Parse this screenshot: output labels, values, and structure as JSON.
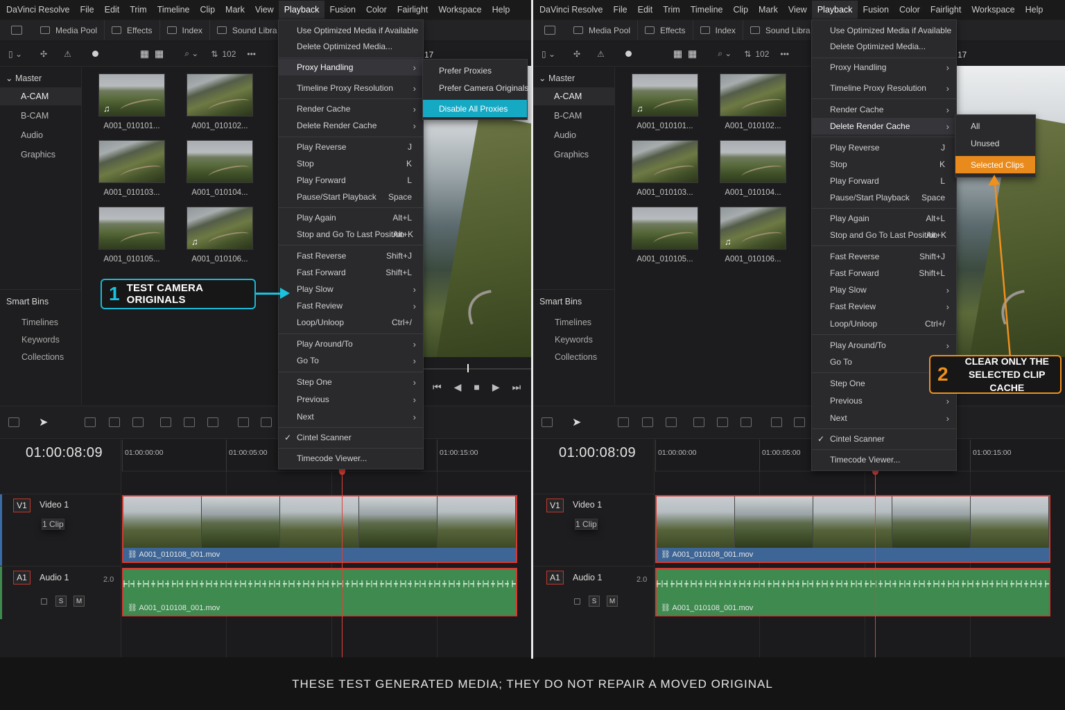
{
  "menubar": [
    "DaVinci Resolve",
    "File",
    "Edit",
    "Trim",
    "Timeline",
    "Clip",
    "Mark",
    "View",
    "Playback",
    "Fusion",
    "Color",
    "Fairlight",
    "Workspace",
    "Help"
  ],
  "toolbar": {
    "media_pool": "Media Pool",
    "effects": "Effects",
    "index": "Index",
    "sound_library": "Sound Libra",
    "zoom_count": "102"
  },
  "sidebar": {
    "master": "Master",
    "bins": [
      "A-CAM",
      "B-CAM",
      "Audio",
      "Graphics"
    ],
    "smart_bins_title": "Smart Bins",
    "smart_bins": [
      "Timelines",
      "Keywords",
      "Collections"
    ]
  },
  "clips": [
    "A001_010101...",
    "A001_010102...",
    "A001_010103...",
    "A001_010104...",
    "A001_010105...",
    "A001_010106..."
  ],
  "viewer": {
    "timecode_left": "17",
    "timecode_right": "17"
  },
  "timeline": {
    "timecode": "01:00:08:09",
    "ruler": [
      "01:00:00:00",
      "01:00:05:00",
      "01:00:15:00"
    ],
    "video_track": {
      "badge": "V1",
      "name": "Video 1",
      "sub": "1 Clip"
    },
    "audio_track": {
      "badge": "A1",
      "name": "Audio 1",
      "level": "2.0",
      "solo": "S",
      "mute": "M"
    },
    "clip_name": "A001_010108_001.mov"
  },
  "playback_menu": {
    "items": [
      {
        "label": "Use Optimized Media if Available"
      },
      {
        "label": "Delete Optimized Media..."
      },
      {
        "label": "Proxy Handling",
        "submenu": true
      },
      {
        "label": "Timeline Proxy Resolution",
        "submenu": true
      },
      {
        "label": "Render Cache",
        "submenu": true
      },
      {
        "label": "Delete Render Cache",
        "submenu": true
      },
      {
        "label": "Play Reverse",
        "shortcut": "J"
      },
      {
        "label": "Stop",
        "shortcut": "K"
      },
      {
        "label": "Play Forward",
        "shortcut": "L"
      },
      {
        "label": "Pause/Start Playback",
        "shortcut": "Space"
      },
      {
        "label": "Play Again",
        "shortcut": "Alt+L"
      },
      {
        "label": "Stop and Go To Last Position",
        "shortcut": "Alt+K"
      },
      {
        "label": "Fast Reverse",
        "shortcut": "Shift+J"
      },
      {
        "label": "Fast Forward",
        "shortcut": "Shift+L"
      },
      {
        "label": "Play Slow",
        "submenu": true
      },
      {
        "label": "Fast Review",
        "submenu": true
      },
      {
        "label": "Loop/Unloop",
        "shortcut": "Ctrl+/"
      },
      {
        "label": "Play Around/To",
        "submenu": true
      },
      {
        "label": "Go To",
        "submenu": true
      },
      {
        "label": "Step One",
        "submenu": true
      },
      {
        "label": "Previous",
        "submenu": true
      },
      {
        "label": "Next",
        "submenu": true
      },
      {
        "label": "Cintel Scanner",
        "checked": true
      },
      {
        "label": "Timecode Viewer..."
      }
    ]
  },
  "proxy_submenu": [
    "Prefer Proxies",
    "Prefer Camera Originals",
    "Disable All Proxies"
  ],
  "render_cache_submenu": [
    "All",
    "Unused",
    "Selected Clips"
  ],
  "callouts": {
    "one_number": "1",
    "one_text": "TEST CAMERA ORIGINALS",
    "two_number": "2",
    "two_line1": "CLEAR ONLY THE",
    "two_line2": "SELECTED CLIP CACHE"
  },
  "footer": "THESE TEST GENERATED MEDIA; THEY DO NOT REPAIR A MOVED ORIGINAL",
  "colors": {
    "cyan": "#16a9c4",
    "orange": "#e98a1d",
    "clip_red": "#d23b34",
    "video_blue": "#3d6595",
    "audio_green": "#3e8a4f"
  }
}
